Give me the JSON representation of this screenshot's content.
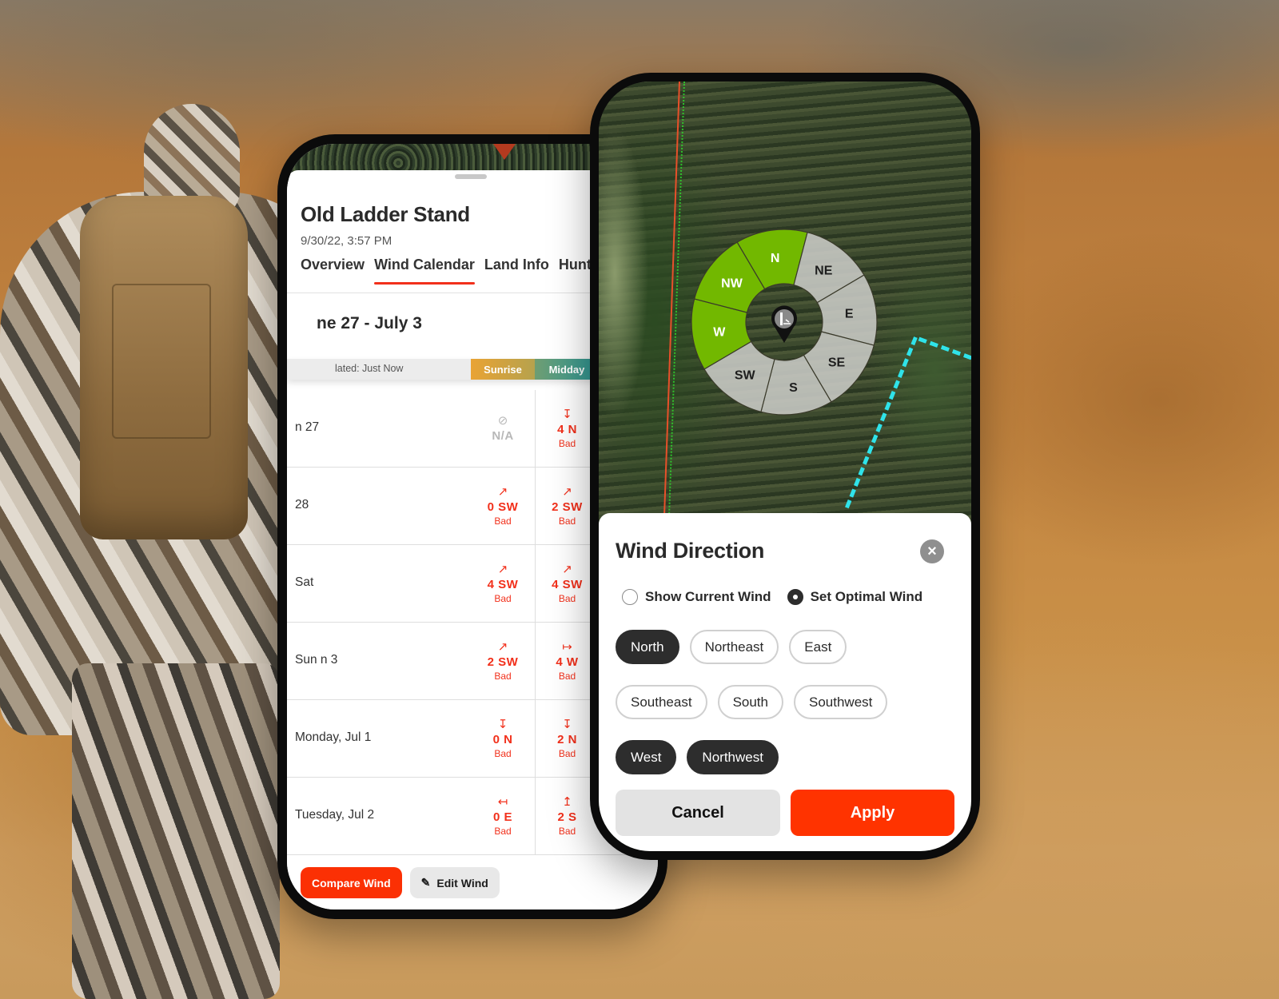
{
  "left_phone": {
    "stand_title": "Old Ladder Stand",
    "stand_date": "9/30/22, 3:57 PM",
    "tabs": [
      {
        "label": "Overview",
        "active": false
      },
      {
        "label": "Wind Calendar",
        "active": true
      },
      {
        "label": "Land Info",
        "active": false
      },
      {
        "label": "Hunt L",
        "active": false
      }
    ],
    "week_title": "ne 27 - July 3",
    "updated_label": "lated:  Just Now",
    "columns": {
      "sunrise": "Sunrise",
      "midday": "Midday"
    },
    "colors": {
      "accent": "#f2301b",
      "na": "#b8b8b8",
      "sunrise": "#e9a334",
      "midday": "#2c9a9a"
    },
    "rows": [
      {
        "day": "n 27",
        "sunrise": {
          "icon": "⊘",
          "value": "N/A",
          "quality": "",
          "na": true
        },
        "midday": {
          "icon": "↧",
          "value": "4 N",
          "quality": "Bad"
        }
      },
      {
        "day": "28",
        "sunrise": {
          "icon": "↗",
          "value": "0 SW",
          "quality": "Bad"
        },
        "midday": {
          "icon": "↗",
          "value": "2 SW",
          "quality": "Bad"
        }
      },
      {
        "day": "Sat",
        "sunrise": {
          "icon": "↗",
          "value": "4 SW",
          "quality": "Bad"
        },
        "midday": {
          "icon": "↗",
          "value": "4 SW",
          "quality": "Bad"
        }
      },
      {
        "day": "Sun         n 3",
        "sunrise": {
          "icon": "↗",
          "value": "2 SW",
          "quality": "Bad"
        },
        "midday": {
          "icon": "↦",
          "value": "4 W",
          "quality": "Bad"
        }
      },
      {
        "day": "Monday, Jul 1",
        "sunrise": {
          "icon": "↧",
          "value": "0 N",
          "quality": "Bad"
        },
        "midday": {
          "icon": "↧",
          "value": "2 N",
          "quality": "Bad"
        }
      },
      {
        "day": "Tuesday, Jul 2",
        "sunrise": {
          "icon": "↤",
          "value": "0 E",
          "quality": "Bad"
        },
        "midday": {
          "icon": "↥",
          "value": "2 S",
          "quality": "Bad"
        }
      }
    ],
    "actions": {
      "compare": "Compare Wind",
      "edit": "Edit Wind",
      "edit_icon": "pencil-icon"
    }
  },
  "right_phone": {
    "rose": {
      "sectors": [
        {
          "label": "N",
          "selected": true
        },
        {
          "label": "NE",
          "selected": false
        },
        {
          "label": "E",
          "selected": false
        },
        {
          "label": "SE",
          "selected": false
        },
        {
          "label": "S",
          "selected": false
        },
        {
          "label": "SW",
          "selected": false
        },
        {
          "label": "W",
          "selected": true
        },
        {
          "label": "NW",
          "selected": true
        }
      ],
      "colors": {
        "selected": "#72b800",
        "unselected": "#c9cbc6"
      },
      "center_icon": "ladder-stand-pin-icon"
    },
    "panel": {
      "title": "Wind Direction",
      "close_icon": "×",
      "radios": [
        {
          "label": "Show Current Wind",
          "checked": false
        },
        {
          "label": "Set Optimal Wind",
          "checked": true
        }
      ],
      "chips": [
        {
          "label": "North",
          "selected": true
        },
        {
          "label": "Northeast",
          "selected": false
        },
        {
          "label": "East",
          "selected": false
        },
        {
          "label": "Southeast",
          "selected": false
        },
        {
          "label": "South",
          "selected": false
        },
        {
          "label": "Southwest",
          "selected": false
        },
        {
          "label": "West",
          "selected": true
        },
        {
          "label": "Northwest",
          "selected": true
        }
      ],
      "cancel": "Cancel",
      "apply": "Apply",
      "colors": {
        "apply": "#ff3300",
        "chip_selected": "#2d2d2d"
      }
    }
  }
}
